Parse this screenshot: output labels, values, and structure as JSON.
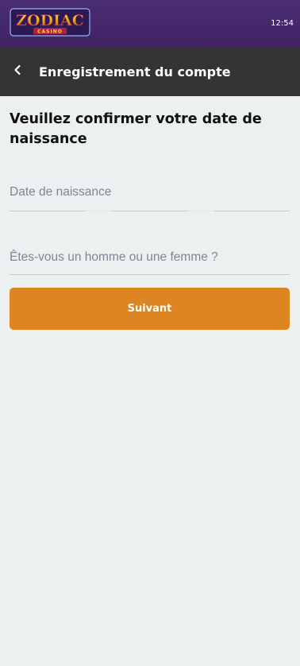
{
  "status_bar": {
    "time": "12:54"
  },
  "brand": {
    "logo_text": "ZODIAC",
    "logo_subtext": "CASINO"
  },
  "nav": {
    "back_icon": "chevron-left-icon",
    "title": "Enregistrement du compte"
  },
  "form": {
    "heading": "Veuillez confirmer votre date de naissance",
    "birthdate_label": "Date de naissance",
    "gender_label": "Êtes-vous un homme ou une femme ?",
    "next_label": "Suivant"
  },
  "colors": {
    "header_purple": "#4b2c73",
    "nav_dark": "#353333",
    "background": "#edf0f1",
    "button_orange": "#dd8520",
    "placeholder_gray": "#7a8891"
  }
}
